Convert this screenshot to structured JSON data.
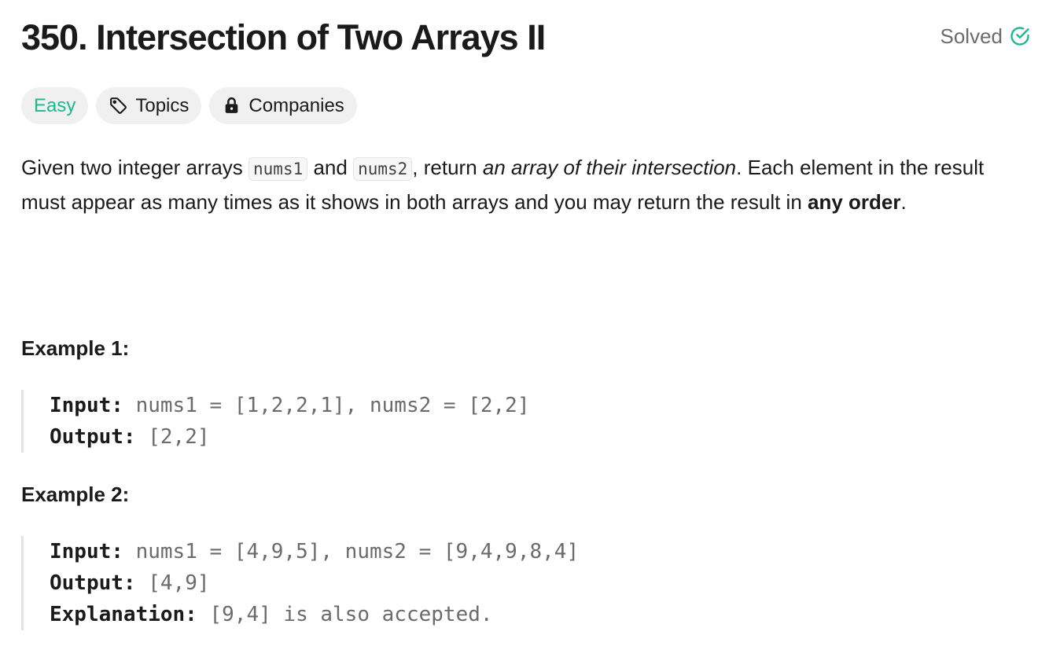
{
  "problem": {
    "title": "350. Intersection of Two Arrays II",
    "status": "Solved",
    "colors": {
      "easy": "#1cb88a",
      "solved_icon": "#1cb88a",
      "text": "#1a1a1a",
      "muted": "#6b6b6b"
    }
  },
  "tags": {
    "difficulty": "Easy",
    "topics": "Topics",
    "companies": "Companies"
  },
  "description": {
    "p1": "Given two integer arrays ",
    "code1": "nums1",
    "p2": " and ",
    "code2": "nums2",
    "p3": ", return ",
    "emph": "an array of their intersection",
    "p4": ". Each element in the result must appear as many times as it shows in both arrays and you may return the result in ",
    "strong": "any order",
    "p5": "."
  },
  "examples": [
    {
      "title": "Example 1:",
      "input_label": "Input:",
      "input_value": " nums1 = [1,2,2,1], nums2 = [2,2]",
      "output_label": "Output:",
      "output_value": " [2,2]"
    },
    {
      "title": "Example 2:",
      "input_label": "Input:",
      "input_value": " nums1 = [4,9,5], nums2 = [9,4,9,8,4]",
      "output_label": "Output:",
      "output_value": " [4,9]",
      "explanation_label": "Explanation:",
      "explanation_value": " [9,4] is also accepted."
    }
  ]
}
